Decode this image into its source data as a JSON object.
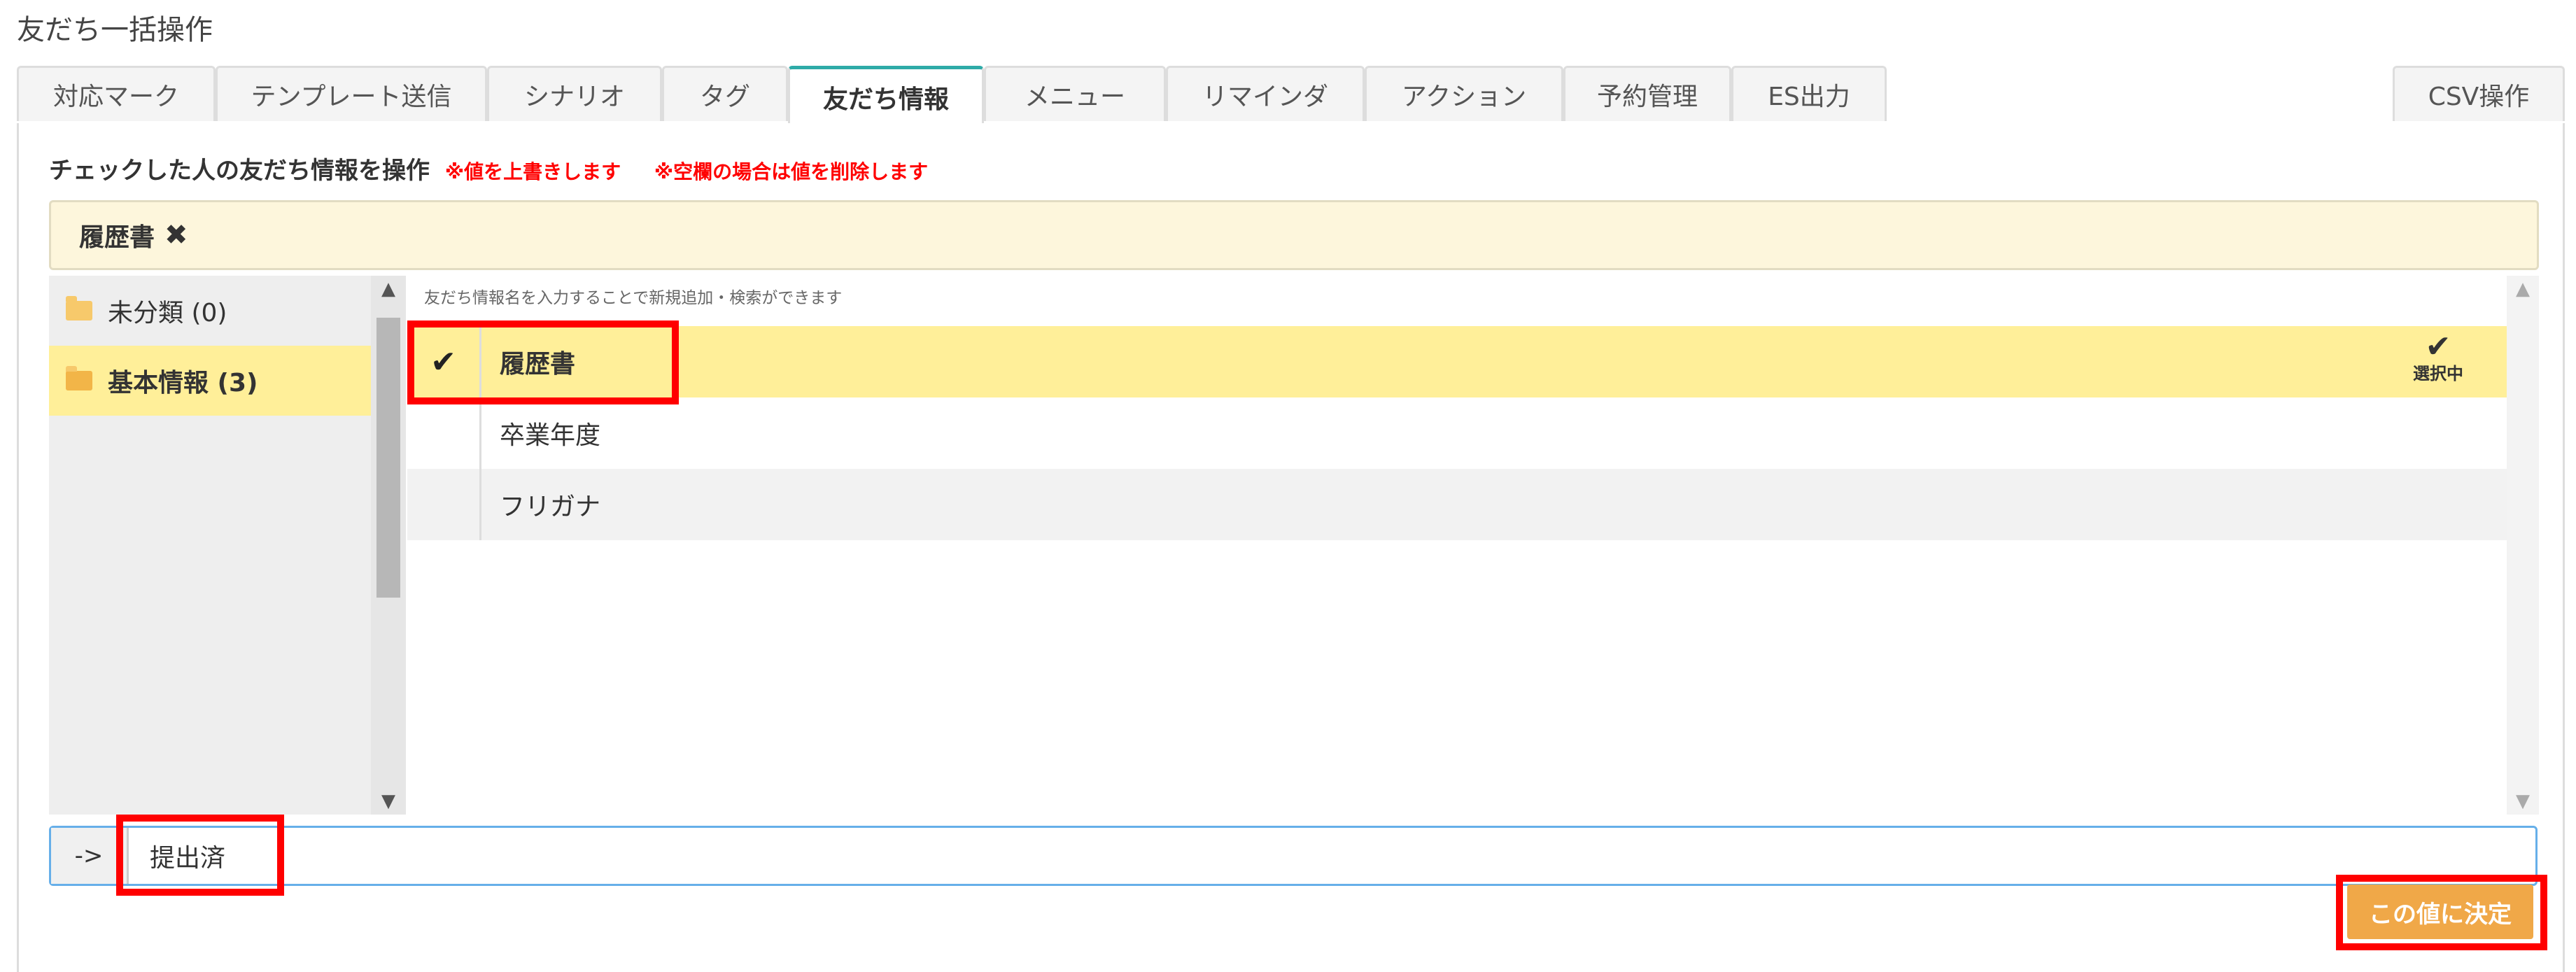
{
  "page_title": "友だち一括操作",
  "tabs": [
    {
      "label": "対応マーク"
    },
    {
      "label": "テンプレート送信"
    },
    {
      "label": "シナリオ"
    },
    {
      "label": "タグ"
    },
    {
      "label": "友だち情報",
      "active": true
    },
    {
      "label": "メニュー"
    },
    {
      "label": "リマインダ"
    },
    {
      "label": "アクション"
    },
    {
      "label": "予約管理"
    },
    {
      "label": "ES出力"
    },
    {
      "label": "CSV操作"
    }
  ],
  "notice": {
    "heading": "チェックした人の友だち情報を操作",
    "warning_overwrite": "※値を上書きします",
    "warning_blank": "※空欄の場合は値を削除します"
  },
  "selected_chip": {
    "label": "履歴書",
    "remove_icon": "✖"
  },
  "folders": [
    {
      "label": "未分類 (0)",
      "icon": "folder-icon"
    },
    {
      "label": "基本情報 (3)",
      "icon": "folder-open-icon",
      "active": true
    }
  ],
  "list_hint": "友だち情報名を入力することで新規追加・検索ができます",
  "items": [
    {
      "label": "履歴書",
      "checked": true,
      "status": "選択中"
    },
    {
      "label": "卒業年度"
    },
    {
      "label": "フリガナ"
    }
  ],
  "check_mark": "✔",
  "value_row": {
    "addon": "->",
    "value": "提出済"
  },
  "decide_button": "この値に決定",
  "colors": {
    "accent_tab": "#2eaba8",
    "selected_row": "#ffef99",
    "button": "#f0a848",
    "highlight": "#ff0000",
    "warning": "#ff0000"
  }
}
